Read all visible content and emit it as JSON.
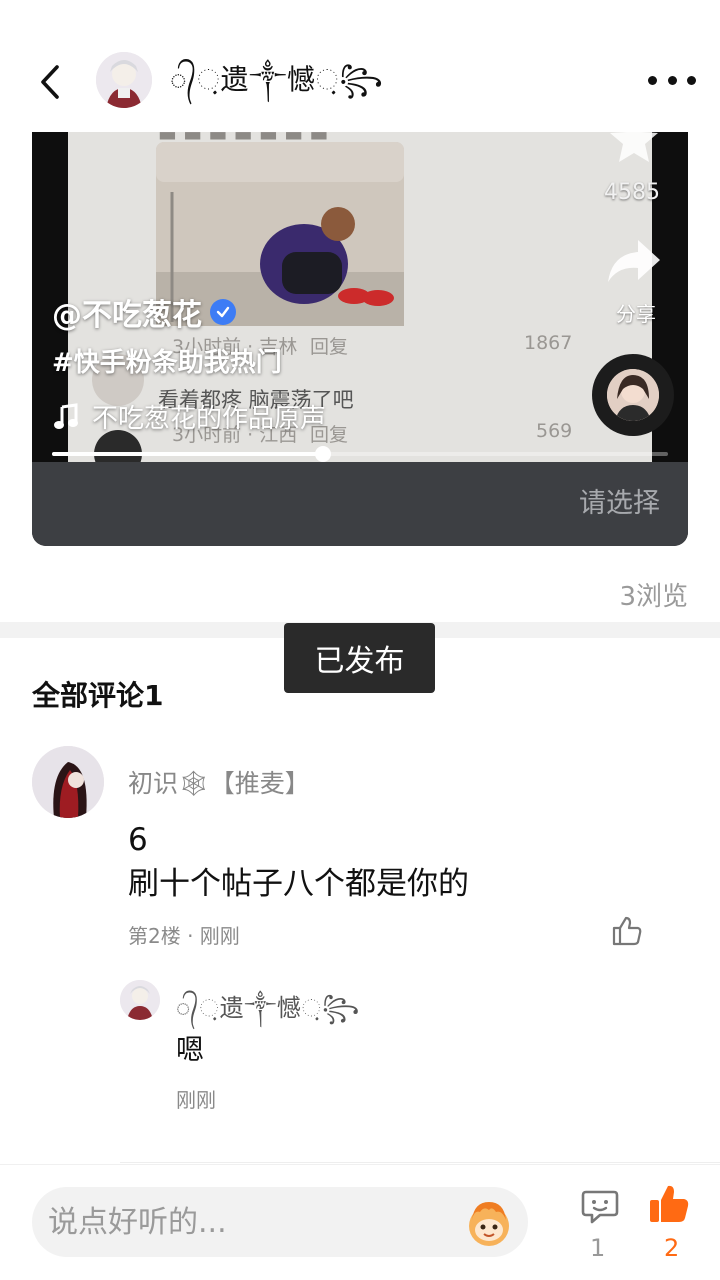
{
  "header": {
    "back_icon": "chevron-left-icon",
    "username": "◌᭄ᨘ遗༒憾ᨘ꧂",
    "more_icon": "more-dots-icon"
  },
  "video": {
    "author": "@不吃葱花",
    "hashtag": "#快手粉条助我热门",
    "music": "不吃葱花的作品原声",
    "side_count": "4585",
    "share_label": "分享",
    "progress": 0.44,
    "select_label": "请选择",
    "bg_comments": [
      {
        "text": "3小时前 · 吉林",
        "reply": "回复",
        "likes": "1867"
      },
      {
        "text": "看着都疼 脑震荡了吧",
        "reply": "",
        "likes": ""
      },
      {
        "text": "3小时前 · 江西",
        "reply": "回复",
        "likes": "569"
      }
    ]
  },
  "stats": {
    "views": "3浏览"
  },
  "toast": "已发布",
  "comments": {
    "title": "全部评论1",
    "items": [
      {
        "username": "初识🕸【推麦】",
        "text_line1": "6",
        "text_line2": "刷十个帖子八个都是你的",
        "meta": "第2楼 · 刚刚",
        "reply": {
          "username": "◌᭄ᨘ遗༒憾ᨘ꧂",
          "text": "嗯",
          "meta": "刚刚"
        }
      }
    ]
  },
  "bottom_bar": {
    "placeholder": "说点好听的...",
    "comment_count": "1",
    "like_count": "2",
    "accent": "#ff6a13"
  }
}
